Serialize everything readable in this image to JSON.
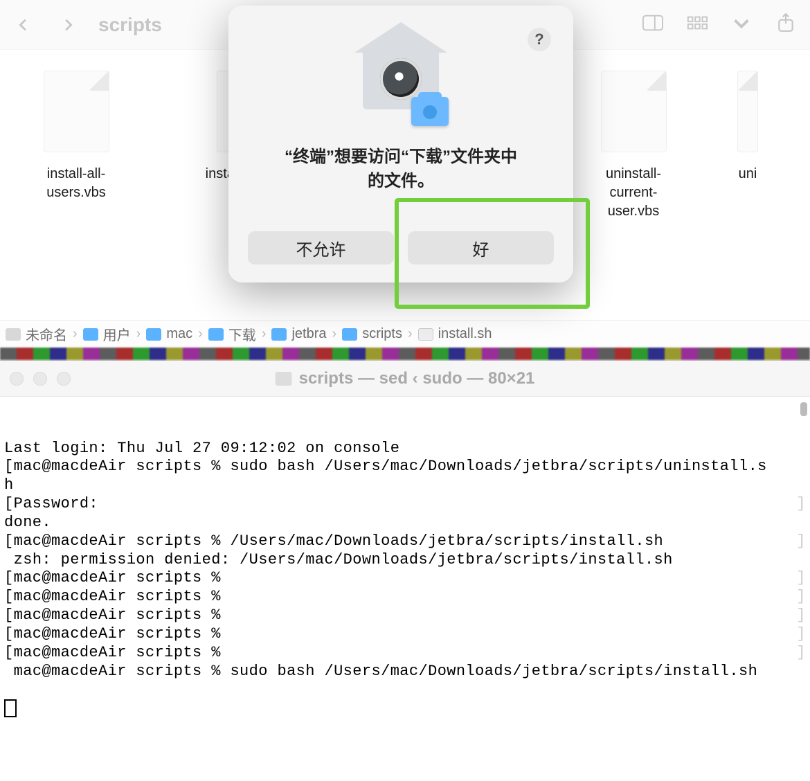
{
  "finder": {
    "title": "scripts",
    "files": [
      {
        "name": "install-all-users.vbs"
      },
      {
        "name": "install-current-user.vbs",
        "display": "install-current-user.vl"
      },
      {
        "name": "uninstall-current-user.vbs"
      },
      {
        "name_partial": "uni"
      }
    ],
    "path": [
      {
        "label": "未命名",
        "icon": "disk"
      },
      {
        "label": "用户",
        "icon": "folder"
      },
      {
        "label": "mac",
        "icon": "folder"
      },
      {
        "label": "下载",
        "icon": "folder"
      },
      {
        "label": "jetbra",
        "icon": "folder"
      },
      {
        "label": "scripts",
        "icon": "folder"
      },
      {
        "label": "install.sh",
        "icon": "file"
      }
    ]
  },
  "dialog": {
    "help_glyph": "?",
    "message_line1": "“终端”想要访问“下载”文件夹中",
    "message_line2": "的文件。",
    "deny_label": "不允许",
    "allow_label": "好"
  },
  "terminal": {
    "title": "scripts — sed ‹ sudo — 80×21",
    "lines": [
      "Last login: Thu Jul 27 09:12:02 on console",
      "[mac@macdeAir scripts % sudo bash /Users/mac/Downloads/jetbra/scripts/uninstall.s",
      "h",
      "[Password:",
      "done.",
      "[mac@macdeAir scripts % /Users/mac/Downloads/jetbra/scripts/install.sh",
      " zsh: permission denied: /Users/mac/Downloads/jetbra/scripts/install.sh",
      "[mac@macdeAir scripts %",
      "[mac@macdeAir scripts %",
      "[mac@macdeAir scripts %",
      "[mac@macdeAir scripts %",
      "[mac@macdeAir scripts %",
      " mac@macdeAir scripts % sudo bash /Users/mac/Downloads/jetbra/scripts/install.sh"
    ]
  }
}
